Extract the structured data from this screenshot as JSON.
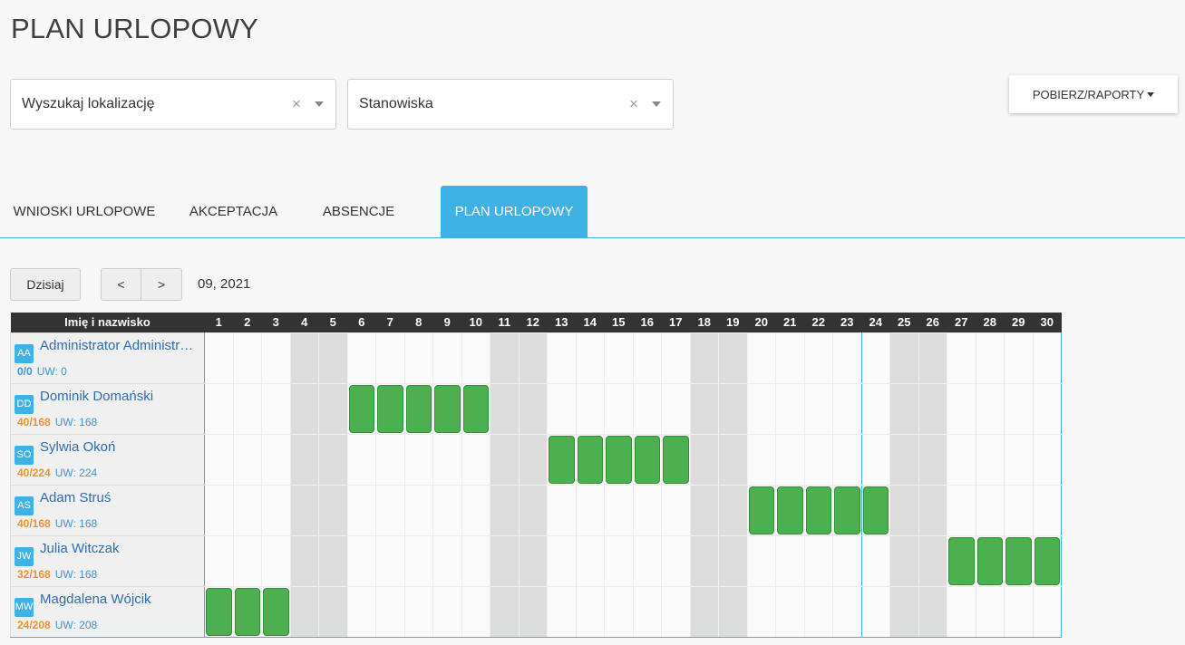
{
  "page": {
    "title": "PLAN URLOPOWY"
  },
  "filters": {
    "location": {
      "placeholder": "Wyszukaj lokalizację"
    },
    "positions": {
      "placeholder": "Stanowiska"
    },
    "clear_glyph": "×"
  },
  "reports_button": {
    "label": "POBIERZ/RAPORTY"
  },
  "tabs": [
    {
      "label": "WNIOSKI URLOPOWE",
      "active": false
    },
    {
      "label": "AKCEPTACJA",
      "active": false
    },
    {
      "label": "ABSENCJE",
      "active": false
    },
    {
      "label": "PLAN URLOPOWY",
      "active": true
    }
  ],
  "nav": {
    "today_label": "Dzisiaj",
    "prev_label": "<",
    "next_label": ">",
    "period": "09, 2021"
  },
  "grid": {
    "name_header": "Imię i nazwisko",
    "days": [
      "1",
      "2",
      "3",
      "4",
      "5",
      "6",
      "7",
      "8",
      "9",
      "10",
      "11",
      "12",
      "13",
      "14",
      "15",
      "16",
      "17",
      "18",
      "19",
      "20",
      "21",
      "22",
      "23",
      "24",
      "25",
      "26",
      "27",
      "28",
      "29",
      "30"
    ],
    "weekend_days": [
      4,
      5,
      11,
      12,
      18,
      19,
      25,
      26
    ],
    "employees": [
      {
        "initials": "AA",
        "name": "Administrator Administrator",
        "used": "0/0",
        "uw": "UW: 0",
        "used_color": "#3e97d0",
        "leave_days": []
      },
      {
        "initials": "DD",
        "name": "Dominik Domański",
        "used": "40/168",
        "uw": "UW: 168",
        "used_color": "#f0922a",
        "leave_days": [
          6,
          7,
          8,
          9,
          10
        ]
      },
      {
        "initials": "SO",
        "name": "Sylwia Okoń",
        "used": "40/224",
        "uw": "UW: 224",
        "used_color": "#f0922a",
        "leave_days": [
          13,
          14,
          15,
          16,
          17
        ]
      },
      {
        "initials": "AS",
        "name": "Adam Struś",
        "used": "40/168",
        "uw": "UW: 168",
        "used_color": "#f0922a",
        "leave_days": [
          20,
          21,
          22,
          23,
          24
        ]
      },
      {
        "initials": "JW",
        "name": "Julia Witczak",
        "used": "32/168",
        "uw": "UW: 168",
        "used_color": "#f0922a",
        "leave_days": [
          27,
          28,
          29,
          30
        ]
      },
      {
        "initials": "MW",
        "name": "Magdalena Wójcik",
        "used": "24/208",
        "uw": "UW: 208",
        "used_color": "#f0922a",
        "leave_days": [
          1,
          2,
          3
        ]
      }
    ]
  },
  "colors": {
    "accent": "#3eb1e5",
    "leave": "#4caf50",
    "weekend": "#dcdcdc"
  }
}
